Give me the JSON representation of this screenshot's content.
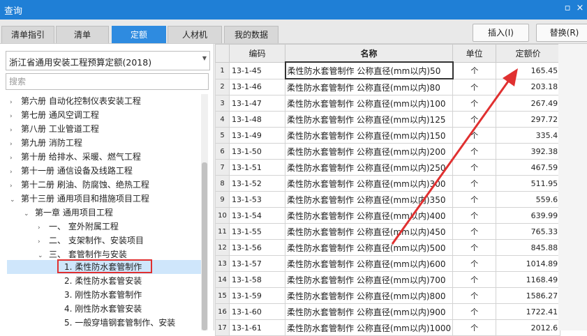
{
  "window": {
    "title": "查询",
    "minimize_glyph": "▫",
    "close_glyph": "×"
  },
  "tabs": [
    {
      "label": "清单指引",
      "active": false
    },
    {
      "label": "清单",
      "active": false
    },
    {
      "label": "定额",
      "active": true
    },
    {
      "label": "人材机",
      "active": false
    },
    {
      "label": "我的数据",
      "active": false
    }
  ],
  "actions": {
    "insert": "插入(I)",
    "replace": "替换(R)"
  },
  "left": {
    "dropdown_value": "浙江省通用安装工程预算定额(2018)",
    "search_placeholder": "搜索",
    "tree": [
      {
        "label": "第六册 自动化控制仪表安装工程",
        "arrow": "›"
      },
      {
        "label": "第七册 通风空调工程",
        "arrow": "›"
      },
      {
        "label": "第八册 工业管道工程",
        "arrow": "›"
      },
      {
        "label": "第九册 消防工程",
        "arrow": "›"
      },
      {
        "label": "第十册 给排水、采暖、燃气工程",
        "arrow": "›"
      },
      {
        "label": "第十一册 通信设备及线路工程",
        "arrow": "›"
      },
      {
        "label": "第十二册 刷油、防腐蚀、绝热工程",
        "arrow": "›"
      },
      {
        "label": "第十三册 通用项目和措施项目工程",
        "arrow": "⌄"
      },
      {
        "label": "第一章 通用项目工程",
        "arrow": "⌄"
      },
      {
        "label": "一、 室外附属工程",
        "arrow": "›"
      },
      {
        "label": "二、 支架制作、安装项目",
        "arrow": "›"
      },
      {
        "label": "三、 套管制作与安装",
        "arrow": "⌄"
      },
      {
        "label": "1. 柔性防水套管制作",
        "arrow": ""
      },
      {
        "label": "2. 柔性防水套管安装",
        "arrow": ""
      },
      {
        "label": "3. 刚性防水套管制作",
        "arrow": ""
      },
      {
        "label": "4. 刚性防水套管安装",
        "arrow": ""
      },
      {
        "label": "5. 一般穿墙钢套管制作、安装",
        "arrow": ""
      }
    ]
  },
  "grid": {
    "columns": [
      "编码",
      "名称",
      "单位",
      "定额价"
    ],
    "rows": [
      {
        "idx": "1",
        "code": "13-1-45",
        "name": "柔性防水套管制作 公称直径(mm以内)50",
        "unit": "个",
        "price": "165.45"
      },
      {
        "idx": "2",
        "code": "13-1-46",
        "name": "柔性防水套管制作 公称直径(mm以内)80",
        "unit": "个",
        "price": "203.18"
      },
      {
        "idx": "3",
        "code": "13-1-47",
        "name": "柔性防水套管制作 公称直径(mm以内)100",
        "unit": "个",
        "price": "267.49"
      },
      {
        "idx": "4",
        "code": "13-1-48",
        "name": "柔性防水套管制作 公称直径(mm以内)125",
        "unit": "个",
        "price": "297.72"
      },
      {
        "idx": "5",
        "code": "13-1-49",
        "name": "柔性防水套管制作 公称直径(mm以内)150",
        "unit": "个",
        "price": "335.4"
      },
      {
        "idx": "6",
        "code": "13-1-50",
        "name": "柔性防水套管制作 公称直径(mm以内)200",
        "unit": "个",
        "price": "392.38"
      },
      {
        "idx": "7",
        "code": "13-1-51",
        "name": "柔性防水套管制作 公称直径(mm以内)250",
        "unit": "个",
        "price": "467.59"
      },
      {
        "idx": "8",
        "code": "13-1-52",
        "name": "柔性防水套管制作 公称直径(mm以内)300",
        "unit": "个",
        "price": "511.95"
      },
      {
        "idx": "9",
        "code": "13-1-53",
        "name": "柔性防水套管制作 公称直径(mm以内)350",
        "unit": "个",
        "price": "559.6"
      },
      {
        "idx": "10",
        "code": "13-1-54",
        "name": "柔性防水套管制作 公称直径(mm以内)400",
        "unit": "个",
        "price": "639.99"
      },
      {
        "idx": "11",
        "code": "13-1-55",
        "name": "柔性防水套管制作 公称直径(mm以内)450",
        "unit": "个",
        "price": "765.33"
      },
      {
        "idx": "12",
        "code": "13-1-56",
        "name": "柔性防水套管制作 公称直径(mm以内)500",
        "unit": "个",
        "price": "845.88"
      },
      {
        "idx": "13",
        "code": "13-1-57",
        "name": "柔性防水套管制作 公称直径(mm以内)600",
        "unit": "个",
        "price": "1014.89"
      },
      {
        "idx": "14",
        "code": "13-1-58",
        "name": "柔性防水套管制作 公称直径(mm以内)700",
        "unit": "个",
        "price": "1168.49"
      },
      {
        "idx": "15",
        "code": "13-1-59",
        "name": "柔性防水套管制作 公称直径(mm以内)800",
        "unit": "个",
        "price": "1586.27"
      },
      {
        "idx": "16",
        "code": "13-1-60",
        "name": "柔性防水套管制作 公称直径(mm以内)900",
        "unit": "个",
        "price": "1722.41"
      },
      {
        "idx": "17",
        "code": "13-1-61",
        "name": "柔性防水套管制作 公称直径(mm以内)1000",
        "unit": "个",
        "price": "2012.6"
      }
    ]
  },
  "annotation": {
    "color": "#e03030"
  }
}
